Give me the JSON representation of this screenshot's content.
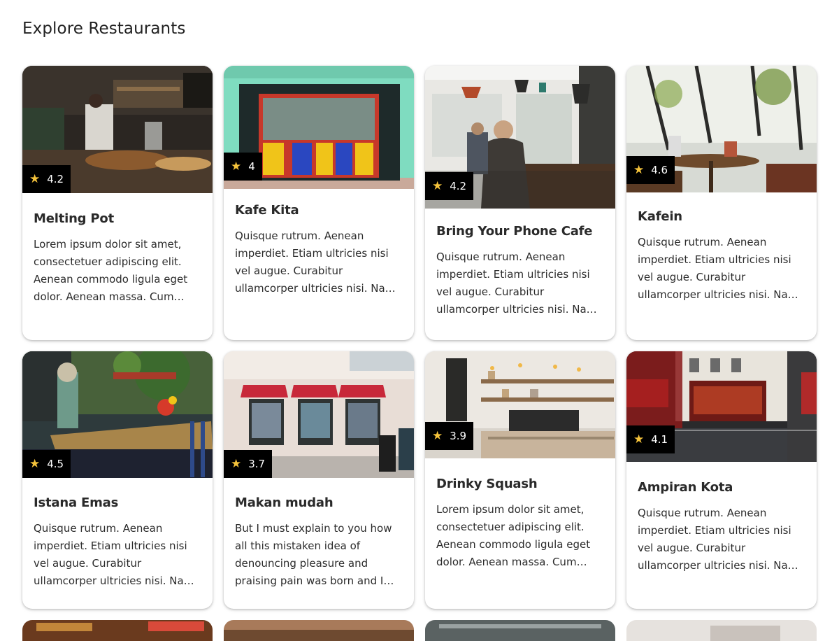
{
  "page": {
    "title": "Explore Restaurants"
  },
  "colors": {
    "star": "#f5c33b",
    "badge_bg": "#000000"
  },
  "restaurants": [
    {
      "name": "Melting Pot",
      "rating": "4.2",
      "description": "Lorem ipsum dolor sit amet, consectetuer adipiscing elit. Aenean commodo ligula eget dolor. Aenean massa. Cum sociis natoque penatibus",
      "icon": "star-icon"
    },
    {
      "name": "Kafe Kita",
      "rating": "4",
      "description": "Quisque rutrum. Aenean imperdiet. Etiam ultricies nisi vel augue. Curabitur ullamcorper ultricies nisi. Nam eget dui.",
      "icon": "star-icon"
    },
    {
      "name": "Bring Your Phone Cafe",
      "rating": "4.2",
      "description": "Quisque rutrum. Aenean imperdiet. Etiam ultricies nisi vel augue. Curabitur ullamcorper ultricies nisi. Nam eget dui.",
      "icon": "star-icon"
    },
    {
      "name": "Kafein",
      "rating": "4.6",
      "description": "Quisque rutrum. Aenean imperdiet. Etiam ultricies nisi vel augue. Curabitur ullamcorper ultricies nisi. Nam eget dui.",
      "icon": "star-icon"
    },
    {
      "name": "Istana Emas",
      "rating": "4.5",
      "description": "Quisque rutrum. Aenean imperdiet. Etiam ultricies nisi vel augue. Curabitur ullamcorper ultricies nisi. Nam eget dui.",
      "icon": "star-icon"
    },
    {
      "name": "Makan mudah",
      "rating": "3.7",
      "description": "But I must explain to you how all this mistaken idea of denouncing pleasure and praising pain was born and I will give you",
      "icon": "star-icon"
    },
    {
      "name": "Drinky Squash",
      "rating": "3.9",
      "description": "Lorem ipsum dolor sit amet, consectetuer adipiscing elit. Aenean commodo ligula eget dolor. Aenean massa. Cum sociis natoque penatibus",
      "icon": "star-icon"
    },
    {
      "name": "Ampiran Kota",
      "rating": "4.1",
      "description": "Quisque rutrum. Aenean imperdiet. Etiam ultricies nisi vel augue. Curabitur ullamcorper ultricies nisi. Nam eget dui.",
      "icon": "star-icon"
    }
  ]
}
